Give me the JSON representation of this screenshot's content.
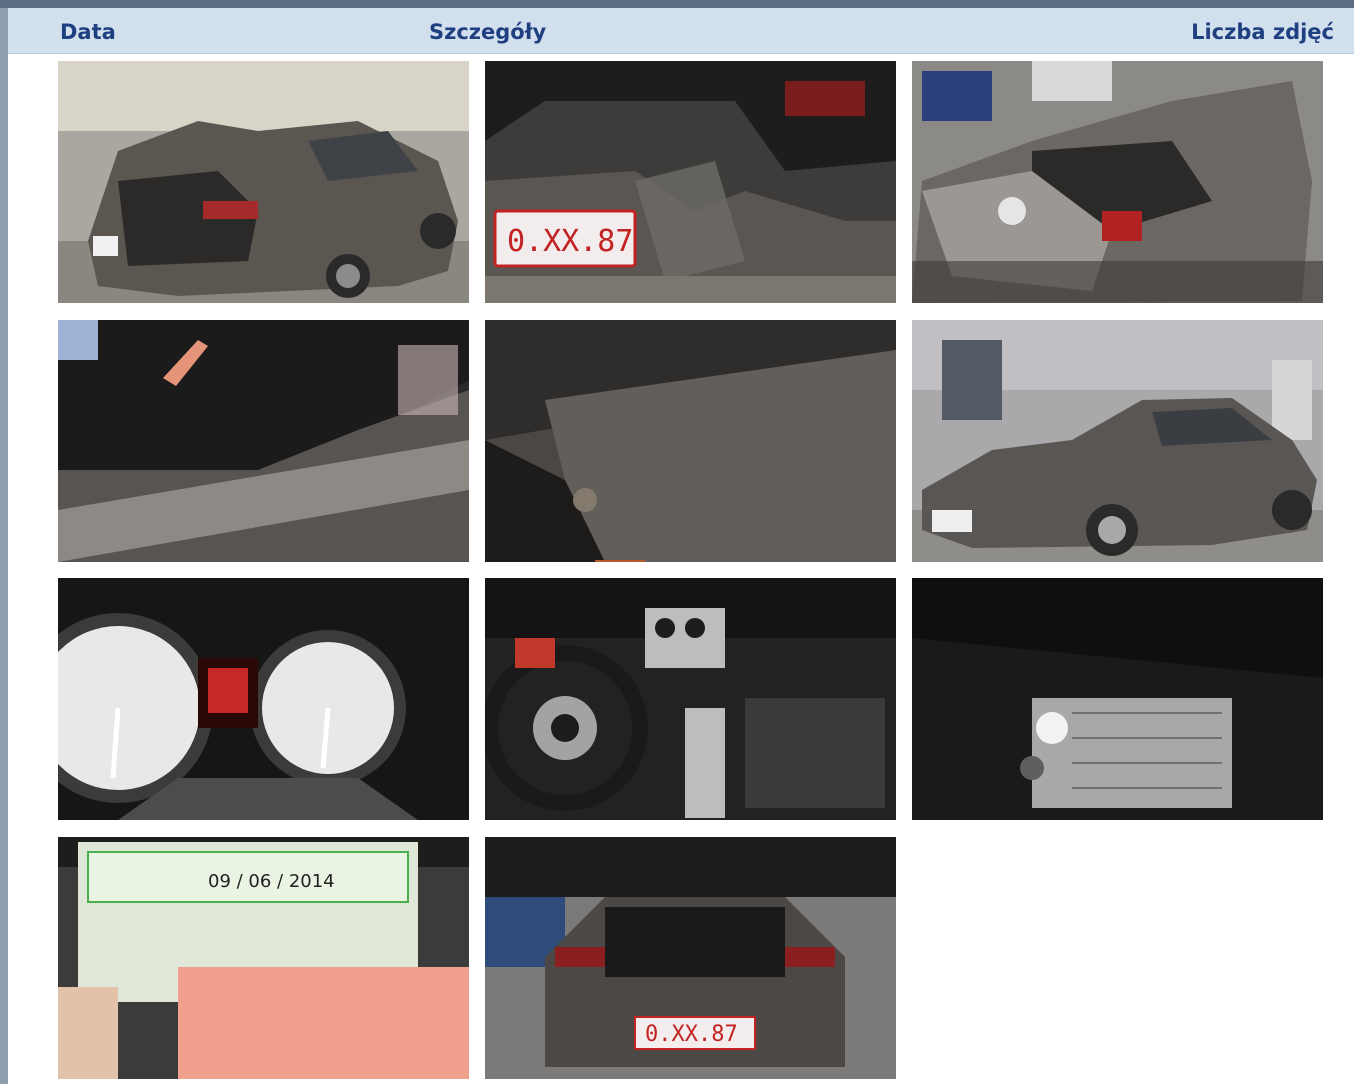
{
  "header": {
    "date_label": "Data",
    "details_label": "Szczegóły",
    "photo_count_label": "Liczba zdjęć"
  },
  "colors": {
    "header_bg": "#d2e0ee",
    "header_text": "#1f3f80",
    "frame": "#5b6e82"
  },
  "photos": [
    {
      "name": "car-rear-trunk-open",
      "plate_text": "",
      "icon": "photo-icon"
    },
    {
      "name": "rear-bumper-plate-closeup",
      "plate_text": "0.XX.87",
      "icon": "photo-icon"
    },
    {
      "name": "crushed-rear-top-view",
      "plate_text": "",
      "icon": "photo-icon"
    },
    {
      "name": "trunk-floor-damage",
      "plate_text": "",
      "icon": "photo-icon"
    },
    {
      "name": "inner-panel-closeup",
      "plate_text": "",
      "icon": "photo-icon"
    },
    {
      "name": "car-front-three-quarter",
      "plate_text": "",
      "icon": "photo-icon"
    },
    {
      "name": "instrument-cluster",
      "plate_text": "",
      "icon": "photo-icon"
    },
    {
      "name": "interior-dashboard",
      "plate_text": "",
      "icon": "photo-icon"
    },
    {
      "name": "vin-plate",
      "plate_text": "",
      "icon": "photo-icon"
    },
    {
      "name": "inspection-certificate",
      "plate_text": "09 / 06 / 2014",
      "icon": "photo-icon"
    },
    {
      "name": "car-rear-full-view",
      "plate_text": "0.XX.87",
      "icon": "photo-icon"
    }
  ]
}
